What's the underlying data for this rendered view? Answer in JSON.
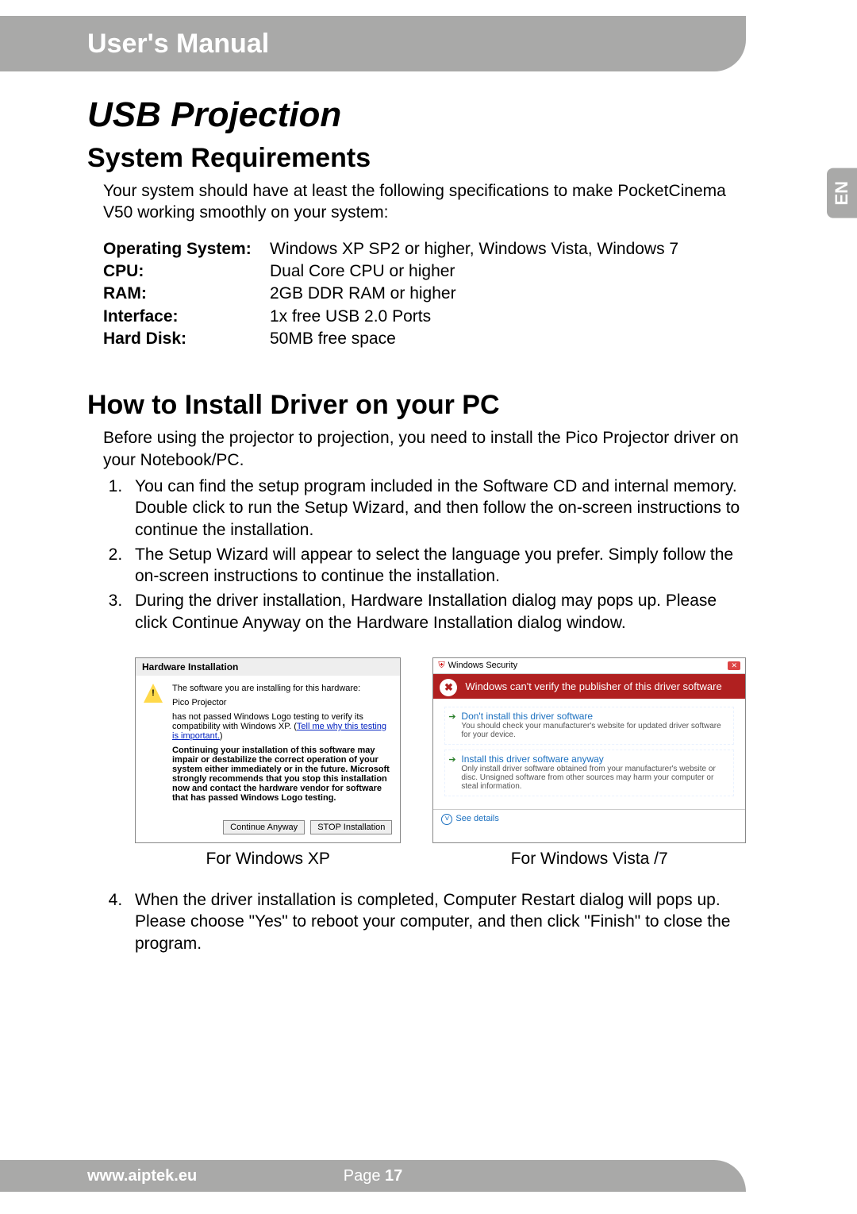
{
  "header": {
    "title": "User's Manual"
  },
  "side_tab": "EN",
  "page_title": "USB Projection",
  "section1": {
    "heading": "System Requirements",
    "intro": "Your system should have at least the following specifications to make PocketCinema V50 working smoothly on your system:",
    "specs": [
      {
        "label": "Operating System:",
        "value": "Windows XP SP2 or higher, Windows Vista, Windows 7"
      },
      {
        "label": "CPU:",
        "value": "Dual Core CPU or higher"
      },
      {
        "label": "RAM:",
        "value": "2GB DDR RAM or higher"
      },
      {
        "label": "Interface:",
        "value": "1x free USB 2.0 Ports"
      },
      {
        "label": "Hard Disk:",
        "value": "50MB free space"
      }
    ]
  },
  "section2": {
    "heading": "How to Install Driver on your PC",
    "intro": "Before using the projector to projection, you need to install the Pico Projector driver on your Notebook/PC.",
    "steps": [
      "You can find the setup program included in the Software CD and internal memory. Double click to run the Setup Wizard, and then follow the on-screen instructions to continue the installation.",
      "The Setup Wizard will appear to select the language you prefer. Simply follow the on-screen instructions to continue the installation.",
      "During the driver installation, Hardware Installation dialog may pops up. Please click Continue Anyway on the Hardware Installation dialog window."
    ],
    "step4": "When the driver installation is completed, Computer Restart dialog will pops up. Please choose \"Yes\" to reboot your computer, and then click \"Finish\" to close the program."
  },
  "dialog_xp": {
    "title": "Hardware Installation",
    "line1": "The software you are installing for this hardware:",
    "device": "Pico Projector",
    "line2a": "has not passed Windows Logo testing to verify its compatibility with Windows XP. (",
    "link": "Tell me why this testing is important.",
    "line2b": ")",
    "bold": "Continuing your installation of this software may impair or destabilize the correct operation of your system either immediately or in the future. Microsoft strongly recommends that you stop this installation now and contact the hardware vendor for software that has passed Windows Logo testing.",
    "btn_continue": "Continue Anyway",
    "btn_stop": "STOP Installation"
  },
  "dialog_vista": {
    "window_title": "Windows Security",
    "banner": "Windows can't verify the publisher of this driver software",
    "opt1_head": "Don't install this driver software",
    "opt1_sub": "You should check your manufacturer's website for updated driver software for your device.",
    "opt2_head": "Install this driver software anyway",
    "opt2_sub": "Only install driver software obtained from your manufacturer's website or disc. Unsigned software from other sources may harm your computer or steal information.",
    "details": "See details"
  },
  "captions": {
    "xp": "For Windows XP",
    "vista": "For Windows Vista /7"
  },
  "footer": {
    "url": "www.aiptek.eu",
    "page_label": "Page ",
    "page_num": "17"
  }
}
